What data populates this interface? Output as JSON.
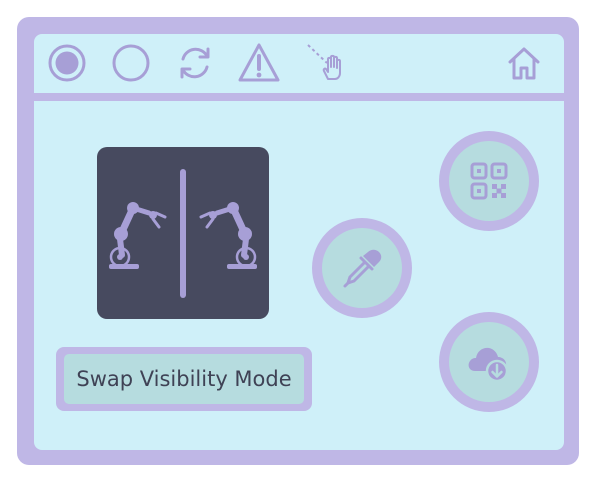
{
  "colors": {
    "frame": "#bfb7e6",
    "background": "#cff0f9",
    "panel": "#474a5f",
    "button_fill": "#b6dcdf",
    "icon": "#a79fd6",
    "text": "#3f4255"
  },
  "toolbar": {
    "icons": [
      "record-filled-icon",
      "record-empty-icon",
      "refresh-icon",
      "warning-icon",
      "pointer-hand-icon",
      "home-icon"
    ]
  },
  "camera_panel": {
    "icons": [
      "robot-arm-left-icon",
      "robot-arm-right-icon"
    ]
  },
  "buttons": {
    "swap_label": "Swap Visibility Mode",
    "qr_icon": "qr-code-icon",
    "dropper_icon": "eyedropper-icon",
    "cloud_icon": "cloud-download-icon"
  }
}
